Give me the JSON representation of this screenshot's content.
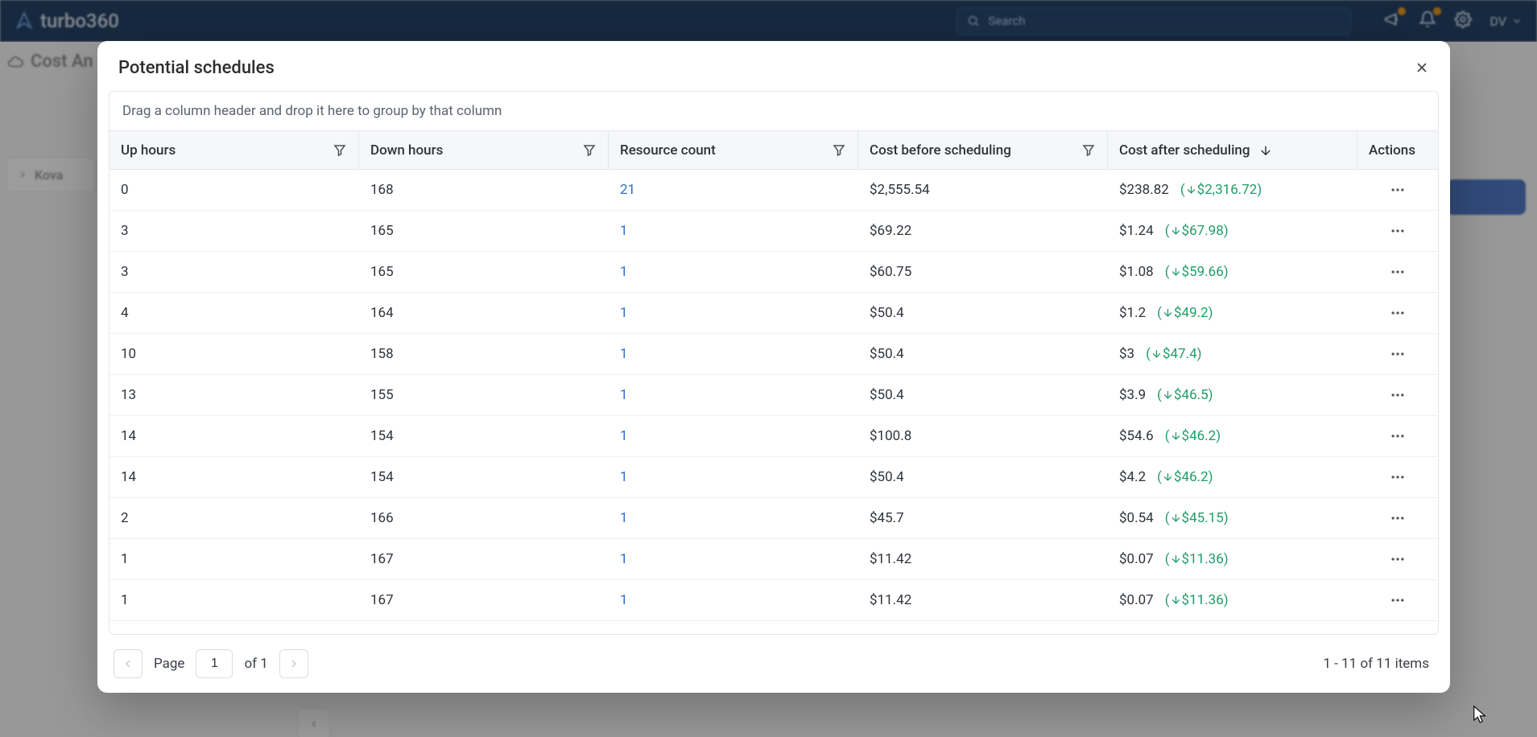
{
  "app": {
    "brand": "turbo360",
    "search_placeholder": "Search",
    "user_initials": "DV"
  },
  "background": {
    "breadcrumb": "Cost An",
    "side_label": "Kova"
  },
  "modal": {
    "title": "Potential schedules",
    "group_drop_hint": "Drag a column header and drop it here to group by that column"
  },
  "columns": {
    "up": "Up hours",
    "down": "Down hours",
    "resource": "Resource count",
    "before": "Cost before scheduling",
    "after": "Cost after scheduling",
    "actions": "Actions",
    "sorted": "after",
    "sort_dir": "desc"
  },
  "rows": [
    {
      "up": "0",
      "down": "168",
      "resource": "21",
      "before": "$2,555.54",
      "after": "$238.82",
      "savings": "$2,316.72"
    },
    {
      "up": "3",
      "down": "165",
      "resource": "1",
      "before": "$69.22",
      "after": "$1.24",
      "savings": "$67.98"
    },
    {
      "up": "3",
      "down": "165",
      "resource": "1",
      "before": "$60.75",
      "after": "$1.08",
      "savings": "$59.66"
    },
    {
      "up": "4",
      "down": "164",
      "resource": "1",
      "before": "$50.4",
      "after": "$1.2",
      "savings": "$49.2"
    },
    {
      "up": "10",
      "down": "158",
      "resource": "1",
      "before": "$50.4",
      "after": "$3",
      "savings": "$47.4"
    },
    {
      "up": "13",
      "down": "155",
      "resource": "1",
      "before": "$50.4",
      "after": "$3.9",
      "savings": "$46.5"
    },
    {
      "up": "14",
      "down": "154",
      "resource": "1",
      "before": "$100.8",
      "after": "$54.6",
      "savings": "$46.2"
    },
    {
      "up": "14",
      "down": "154",
      "resource": "1",
      "before": "$50.4",
      "after": "$4.2",
      "savings": "$46.2"
    },
    {
      "up": "2",
      "down": "166",
      "resource": "1",
      "before": "$45.7",
      "after": "$0.54",
      "savings": "$45.15"
    },
    {
      "up": "1",
      "down": "167",
      "resource": "1",
      "before": "$11.42",
      "after": "$0.07",
      "savings": "$11.36"
    },
    {
      "up": "1",
      "down": "167",
      "resource": "1",
      "before": "$11.42",
      "after": "$0.07",
      "savings": "$11.36"
    }
  ],
  "pager": {
    "page_label": "Page",
    "page": "1",
    "of_label": "of 1",
    "summary": "1 - 11 of 11 items"
  }
}
